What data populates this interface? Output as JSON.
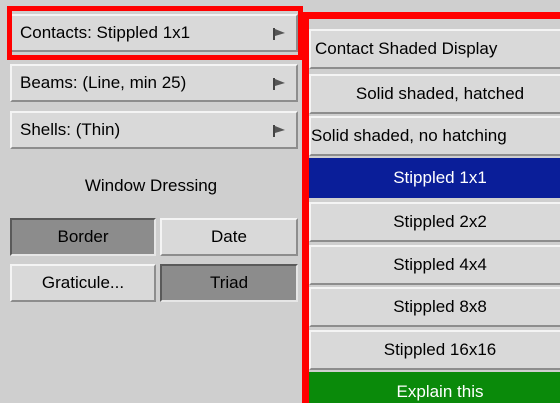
{
  "left_menu": {
    "items": [
      {
        "label": "Contacts: Stippled 1x1"
      },
      {
        "label": "Beams: (Line, min 25)"
      },
      {
        "label": "Shells: (Thin)"
      }
    ],
    "section_title": "Window Dressing",
    "buttons": [
      {
        "label": "Border",
        "active": true
      },
      {
        "label": "Date",
        "active": false
      },
      {
        "label": "Graticule...",
        "active": false
      },
      {
        "label": "Triad",
        "active": true
      }
    ]
  },
  "popup_menu": {
    "title": "Contact Shaded Display",
    "options": [
      {
        "label": "Solid shaded, hatched"
      },
      {
        "label": "Solid shaded, no hatching"
      },
      {
        "label": "Stippled 1x1",
        "selected": true
      },
      {
        "label": "Stippled 2x2"
      },
      {
        "label": "Stippled 4x4"
      },
      {
        "label": "Stippled 8x8"
      },
      {
        "label": "Stippled 16x16"
      }
    ],
    "explain_label": "Explain this"
  },
  "colors": {
    "highlight": "#ff0000",
    "selected": "#0a1e99",
    "explain": "#0a8a0a",
    "panel": "#cfcfcf"
  }
}
